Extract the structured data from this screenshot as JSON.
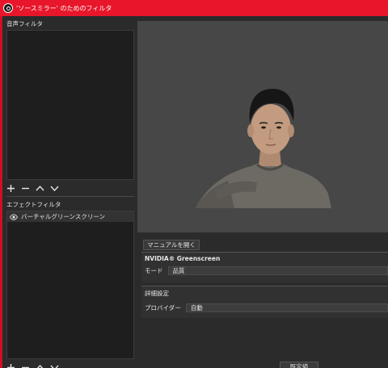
{
  "window": {
    "title": "'ソースミラー' のためのフィルタ"
  },
  "audio_filters": {
    "label": "音声フィルタ",
    "items": []
  },
  "effect_filters": {
    "label": "エフェクトフィルタ",
    "items": [
      {
        "label": "バーチャルグリーンスクリーン",
        "visible": true
      }
    ]
  },
  "toolbar_icons": [
    "add-icon",
    "remove-icon",
    "move-up-icon",
    "move-down-icon"
  ],
  "properties": {
    "manual_button": "マニュアルを開く",
    "section_title": "NVIDIA® Greenscreen",
    "mode_label": "モード",
    "mode_value": "品質",
    "advanced_title": "詳細設定",
    "provider_label": "プロバイダー",
    "provider_value": "自動",
    "defaults_button": "既定値"
  },
  "colors": {
    "titlebar": "#e8162a",
    "background": "#2b2b2b",
    "preview": "#474747"
  }
}
